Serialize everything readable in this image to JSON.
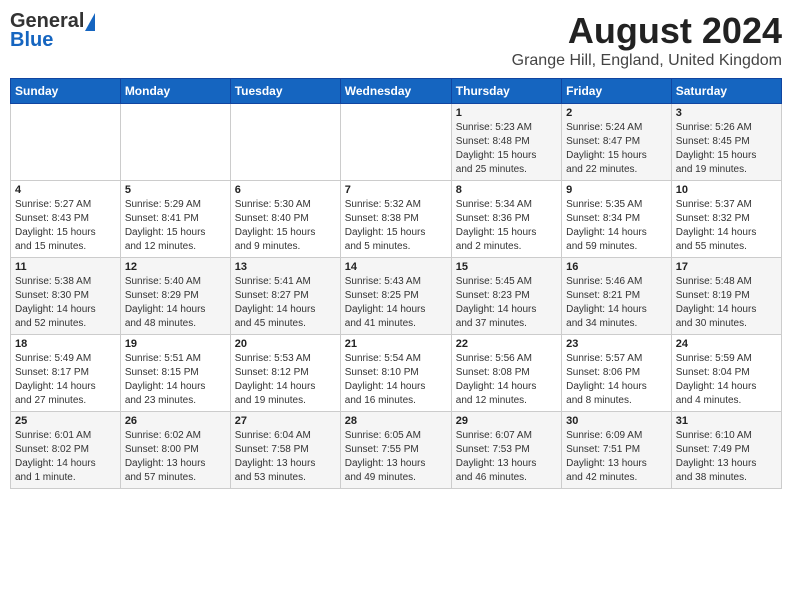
{
  "header": {
    "logo_general": "General",
    "logo_blue": "Blue",
    "month_title": "August 2024",
    "location": "Grange Hill, England, United Kingdom"
  },
  "days_of_week": [
    "Sunday",
    "Monday",
    "Tuesday",
    "Wednesday",
    "Thursday",
    "Friday",
    "Saturday"
  ],
  "weeks": [
    [
      {
        "day": "",
        "info": ""
      },
      {
        "day": "",
        "info": ""
      },
      {
        "day": "",
        "info": ""
      },
      {
        "day": "",
        "info": ""
      },
      {
        "day": "1",
        "info": "Sunrise: 5:23 AM\nSunset: 8:48 PM\nDaylight: 15 hours\nand 25 minutes."
      },
      {
        "day": "2",
        "info": "Sunrise: 5:24 AM\nSunset: 8:47 PM\nDaylight: 15 hours\nand 22 minutes."
      },
      {
        "day": "3",
        "info": "Sunrise: 5:26 AM\nSunset: 8:45 PM\nDaylight: 15 hours\nand 19 minutes."
      }
    ],
    [
      {
        "day": "4",
        "info": "Sunrise: 5:27 AM\nSunset: 8:43 PM\nDaylight: 15 hours\nand 15 minutes."
      },
      {
        "day": "5",
        "info": "Sunrise: 5:29 AM\nSunset: 8:41 PM\nDaylight: 15 hours\nand 12 minutes."
      },
      {
        "day": "6",
        "info": "Sunrise: 5:30 AM\nSunset: 8:40 PM\nDaylight: 15 hours\nand 9 minutes."
      },
      {
        "day": "7",
        "info": "Sunrise: 5:32 AM\nSunset: 8:38 PM\nDaylight: 15 hours\nand 5 minutes."
      },
      {
        "day": "8",
        "info": "Sunrise: 5:34 AM\nSunset: 8:36 PM\nDaylight: 15 hours\nand 2 minutes."
      },
      {
        "day": "9",
        "info": "Sunrise: 5:35 AM\nSunset: 8:34 PM\nDaylight: 14 hours\nand 59 minutes."
      },
      {
        "day": "10",
        "info": "Sunrise: 5:37 AM\nSunset: 8:32 PM\nDaylight: 14 hours\nand 55 minutes."
      }
    ],
    [
      {
        "day": "11",
        "info": "Sunrise: 5:38 AM\nSunset: 8:30 PM\nDaylight: 14 hours\nand 52 minutes."
      },
      {
        "day": "12",
        "info": "Sunrise: 5:40 AM\nSunset: 8:29 PM\nDaylight: 14 hours\nand 48 minutes."
      },
      {
        "day": "13",
        "info": "Sunrise: 5:41 AM\nSunset: 8:27 PM\nDaylight: 14 hours\nand 45 minutes."
      },
      {
        "day": "14",
        "info": "Sunrise: 5:43 AM\nSunset: 8:25 PM\nDaylight: 14 hours\nand 41 minutes."
      },
      {
        "day": "15",
        "info": "Sunrise: 5:45 AM\nSunset: 8:23 PM\nDaylight: 14 hours\nand 37 minutes."
      },
      {
        "day": "16",
        "info": "Sunrise: 5:46 AM\nSunset: 8:21 PM\nDaylight: 14 hours\nand 34 minutes."
      },
      {
        "day": "17",
        "info": "Sunrise: 5:48 AM\nSunset: 8:19 PM\nDaylight: 14 hours\nand 30 minutes."
      }
    ],
    [
      {
        "day": "18",
        "info": "Sunrise: 5:49 AM\nSunset: 8:17 PM\nDaylight: 14 hours\nand 27 minutes."
      },
      {
        "day": "19",
        "info": "Sunrise: 5:51 AM\nSunset: 8:15 PM\nDaylight: 14 hours\nand 23 minutes."
      },
      {
        "day": "20",
        "info": "Sunrise: 5:53 AM\nSunset: 8:12 PM\nDaylight: 14 hours\nand 19 minutes."
      },
      {
        "day": "21",
        "info": "Sunrise: 5:54 AM\nSunset: 8:10 PM\nDaylight: 14 hours\nand 16 minutes."
      },
      {
        "day": "22",
        "info": "Sunrise: 5:56 AM\nSunset: 8:08 PM\nDaylight: 14 hours\nand 12 minutes."
      },
      {
        "day": "23",
        "info": "Sunrise: 5:57 AM\nSunset: 8:06 PM\nDaylight: 14 hours\nand 8 minutes."
      },
      {
        "day": "24",
        "info": "Sunrise: 5:59 AM\nSunset: 8:04 PM\nDaylight: 14 hours\nand 4 minutes."
      }
    ],
    [
      {
        "day": "25",
        "info": "Sunrise: 6:01 AM\nSunset: 8:02 PM\nDaylight: 14 hours\nand 1 minute."
      },
      {
        "day": "26",
        "info": "Sunrise: 6:02 AM\nSunset: 8:00 PM\nDaylight: 13 hours\nand 57 minutes."
      },
      {
        "day": "27",
        "info": "Sunrise: 6:04 AM\nSunset: 7:58 PM\nDaylight: 13 hours\nand 53 minutes."
      },
      {
        "day": "28",
        "info": "Sunrise: 6:05 AM\nSunset: 7:55 PM\nDaylight: 13 hours\nand 49 minutes."
      },
      {
        "day": "29",
        "info": "Sunrise: 6:07 AM\nSunset: 7:53 PM\nDaylight: 13 hours\nand 46 minutes."
      },
      {
        "day": "30",
        "info": "Sunrise: 6:09 AM\nSunset: 7:51 PM\nDaylight: 13 hours\nand 42 minutes."
      },
      {
        "day": "31",
        "info": "Sunrise: 6:10 AM\nSunset: 7:49 PM\nDaylight: 13 hours\nand 38 minutes."
      }
    ]
  ]
}
